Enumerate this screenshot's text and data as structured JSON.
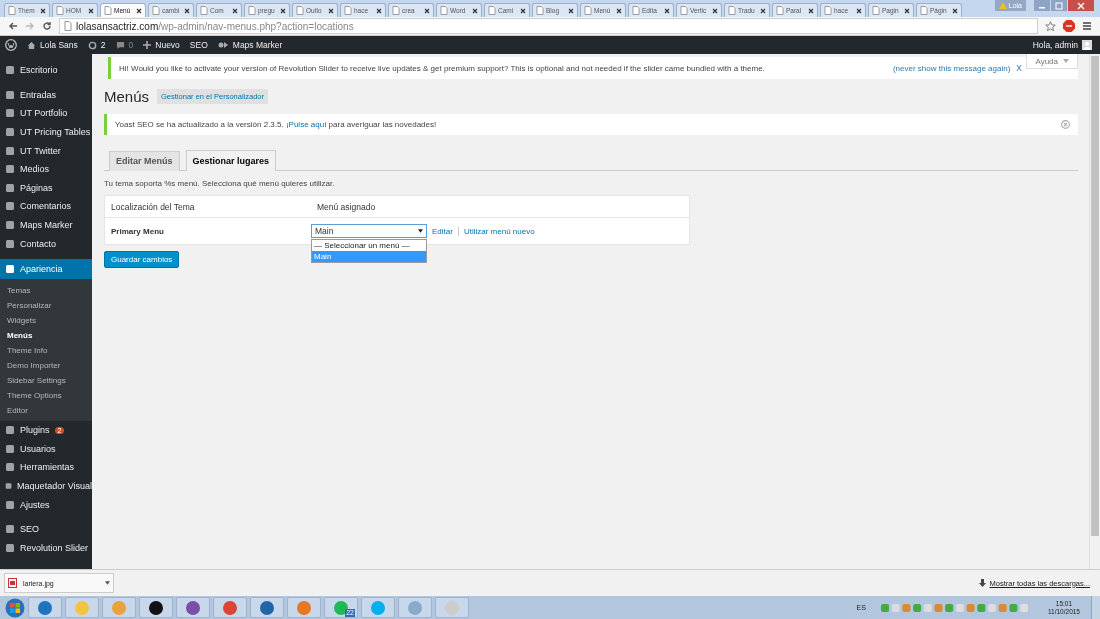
{
  "browser": {
    "tabs": [
      {
        "label": "Them",
        "selected": false
      },
      {
        "label": "HOM",
        "selected": false
      },
      {
        "label": "Menú",
        "selected": true
      },
      {
        "label": "cambi",
        "selected": false
      },
      {
        "label": "Com",
        "selected": false
      },
      {
        "label": "pregu",
        "selected": false
      },
      {
        "label": "Outlo",
        "selected": false
      },
      {
        "label": "hace",
        "selected": false
      },
      {
        "label": "crea",
        "selected": false
      },
      {
        "label": "Word",
        "selected": false
      },
      {
        "label": "Cami",
        "selected": false
      },
      {
        "label": "Blog",
        "selected": false
      },
      {
        "label": "Menú",
        "selected": false
      },
      {
        "label": "Edita",
        "selected": false
      },
      {
        "label": "Vertic",
        "selected": false
      },
      {
        "label": "Tradu",
        "selected": false
      },
      {
        "label": "Paral",
        "selected": false
      },
      {
        "label": "hace",
        "selected": false
      },
      {
        "label": "Pagin",
        "selected": false
      },
      {
        "label": "Págin",
        "selected": false
      }
    ],
    "profile": "Lola",
    "address": {
      "host": "lolasansactriz.com",
      "path": "/wp-admin/nav-menus.php?action=locations"
    }
  },
  "admin_bar": {
    "site": "Lola Sans",
    "updates": "2",
    "comments": "0",
    "new": "Nuevo",
    "seo": "SEO",
    "maps": "Maps Marker",
    "greeting": "Hola, admin"
  },
  "sidebar": {
    "groups": [
      [
        {
          "label": "Escritorio",
          "selected": false
        }
      ],
      [
        {
          "label": "Entradas",
          "selected": false
        },
        {
          "label": "UT Portfolio",
          "selected": false
        },
        {
          "label": "UT Pricing Tables",
          "selected": false
        },
        {
          "label": "UT Twitter",
          "selected": false
        },
        {
          "label": "Medios",
          "selected": false
        },
        {
          "label": "Páginas",
          "selected": false
        },
        {
          "label": "Comentarios",
          "selected": false
        },
        {
          "label": "Maps Marker",
          "selected": false
        },
        {
          "label": "Contacto",
          "selected": false
        }
      ],
      [
        {
          "label": "Apariencia",
          "selected": true,
          "children": [
            {
              "label": "Temas",
              "selected": false
            },
            {
              "label": "Personalizar",
              "selected": false
            },
            {
              "label": "Widgets",
              "selected": false
            },
            {
              "label": "Menús",
              "selected": true
            },
            {
              "label": "Theme Info",
              "selected": false
            },
            {
              "label": "Demo Importer",
              "selected": false
            },
            {
              "label": "Sidebar Settings",
              "selected": false
            },
            {
              "label": "Theme Options",
              "selected": false
            },
            {
              "label": "Editor",
              "selected": false
            }
          ]
        },
        {
          "label": "Plugins",
          "selected": false,
          "badge": "2"
        },
        {
          "label": "Usuarios",
          "selected": false
        },
        {
          "label": "Herramientas",
          "selected": false
        },
        {
          "label": "Maquetador Visual",
          "selected": false
        },
        {
          "label": "Ajustes",
          "selected": false
        }
      ],
      [
        {
          "label": "SEO",
          "selected": false
        },
        {
          "label": "Revolution Slider",
          "selected": false
        }
      ]
    ]
  },
  "help": "Ayuda",
  "slider_notice": {
    "text": "Hi! Would you like to activate your version of Revolution Slider to receive live updates & get premium support? This is optional and not needed if the slider came bundled with a theme.",
    "link": "(never show this message again)",
    "dismiss": "X"
  },
  "page": {
    "title": "Menús",
    "title_action": "Gestionar en el Personalizador"
  },
  "yoast_notice": {
    "before": "Yoast SEO se ha actualizado a la versión 2.3.5. ",
    "link": "¡Pulse aquí",
    "after": " para averiguar las novedades!"
  },
  "tabs": [
    {
      "label": "Editar Menús",
      "selected": false
    },
    {
      "label": "Gestionar lugares",
      "selected": true
    }
  ],
  "description": "Tu tema soporta %s menú. Selecciona qué menú quieres utilizar.",
  "table": {
    "columns": [
      "Localización del Tema",
      "Menú asignado"
    ],
    "rows": [
      {
        "location": "Primary Menu",
        "value": "Main",
        "expanded": true,
        "options": [
          {
            "label": "— Seleccionar un menú —",
            "selected": false
          },
          {
            "label": "Main",
            "selected": true
          }
        ],
        "links": [
          "Editar",
          "Utilizar menú nuevo"
        ]
      }
    ]
  },
  "save": "Guardar cambios",
  "downloads": {
    "file": "lariera.jpg",
    "show_all": "Mostrar todas las descargas..."
  },
  "taskbar": {
    "spotify_badge": "22",
    "language": "ES",
    "time": "15:01",
    "date": "11/10/2015"
  }
}
